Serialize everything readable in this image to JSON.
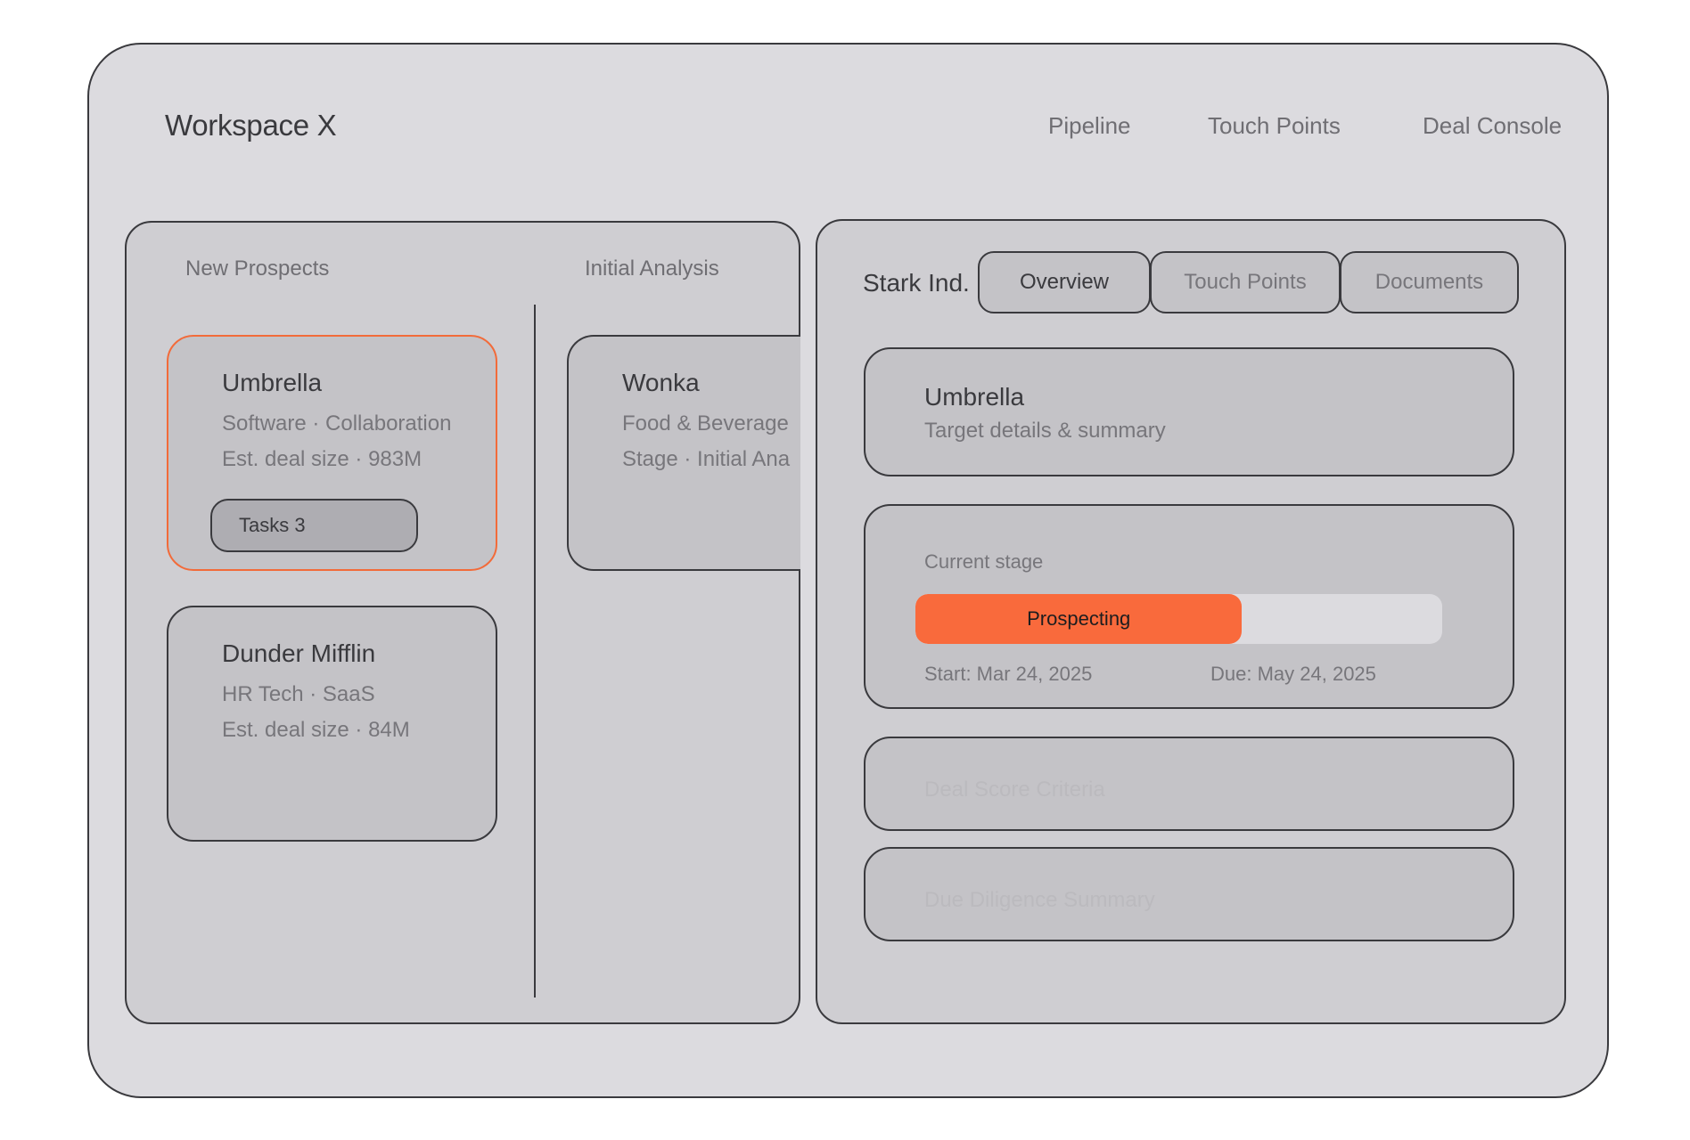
{
  "app": {
    "title": "Workspace X"
  },
  "nav": [
    {
      "label": "Pipeline"
    },
    {
      "label": "Touch Points"
    },
    {
      "label": "Deal Console"
    }
  ],
  "pipeline": {
    "columns": [
      {
        "title": "New Prospects",
        "cards": [
          {
            "name": "Umbrella",
            "sector": "Software · Collaboration",
            "deal": "Est. deal size · 983M",
            "tasks_label": "Tasks 3",
            "selected": true
          },
          {
            "name": "Dunder Mifflin",
            "sector": "HR Tech · SaaS",
            "deal": "Est. deal size · 84M"
          }
        ]
      },
      {
        "title": "Initial Analysis",
        "cards": [
          {
            "name": "Wonka",
            "sector": "Food & Beverage",
            "stage": "Stage · Initial Ana"
          }
        ]
      }
    ]
  },
  "detail": {
    "company": "Stark Ind.",
    "tabs": [
      {
        "label": "Overview",
        "active": true
      },
      {
        "label": "Touch Points"
      },
      {
        "label": "Documents"
      }
    ],
    "summary": {
      "title": "Umbrella",
      "subtitle": "Target details & summary"
    },
    "stage": {
      "label": "Current stage",
      "name": "Prospecting",
      "progress": 0.62,
      "start": "Start: Mar 24, 2025",
      "due": "Due: May 24, 2025"
    },
    "deal_score": "Deal Score Criteria",
    "due_diligence": "Due Diligence Summary"
  },
  "colors": {
    "accent": "#f96a3c",
    "selected_border": "#f26b3a"
  }
}
